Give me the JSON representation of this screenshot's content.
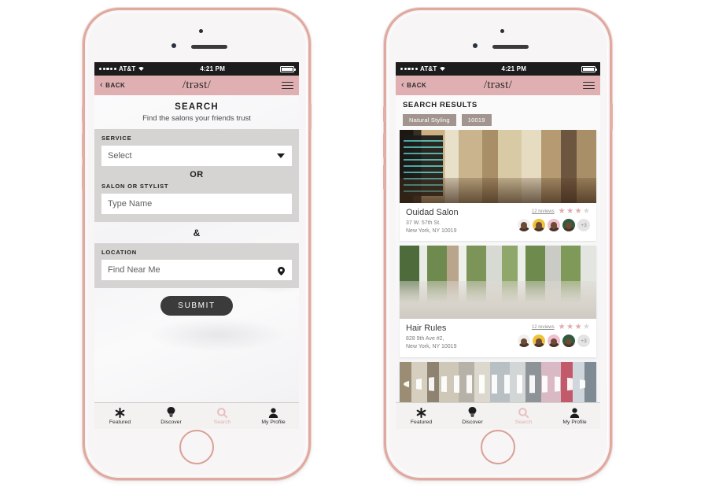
{
  "statusbar": {
    "carrier": "AT&T",
    "time": "4:21 PM",
    "signal_dots": 5
  },
  "navbar": {
    "back_label": "BACK",
    "logo": "/trəst/",
    "menu_icon": "hamburger-icon"
  },
  "left_screen": {
    "heading": "SEARCH",
    "subheading": "Find the salons your friends trust",
    "service": {
      "label": "SERVICE",
      "value": "Select",
      "icon": "chevron-down-icon"
    },
    "divider_or": "OR",
    "salon_or_stylist": {
      "label": "SALON OR STYLIST",
      "placeholder": "Type Name",
      "value": ""
    },
    "divider_and": "&",
    "location": {
      "label": "LOCATION",
      "placeholder": "Find Near Me",
      "value": "",
      "icon": "map-pin-icon"
    },
    "submit_label": "SUBMIT"
  },
  "right_screen": {
    "heading": "SEARCH RESULTS",
    "tags": [
      "Natural Styling",
      "10019"
    ],
    "results": [
      {
        "name": "Ouidad Salon",
        "address_line1": "37 W. 57th St.",
        "address_line2": "New York, NY 10019",
        "reviews": "12 reviews",
        "stars_filled": 3,
        "stars_total": 4,
        "avatar_overflow": "+3",
        "photo": "salon-interior-reception"
      },
      {
        "name": "Hair Rules",
        "address_line1": "828 9th Ave #2,",
        "address_line2": "New York, NY 10019",
        "reviews": "12 reviews",
        "stars_filled": 3,
        "stars_total": 4,
        "avatar_overflow": "+3",
        "photo": "salon-styling-chairs"
      },
      {
        "name": "",
        "address_line1": "",
        "address_line2": "",
        "reviews": "",
        "stars_filled": 0,
        "stars_total": 4,
        "avatar_overflow": "",
        "photo": "salon-vanity-mirrors"
      }
    ]
  },
  "tabbar": {
    "items": [
      {
        "label": "Featured",
        "icon": "asterisk-icon",
        "active": false
      },
      {
        "label": "Discover",
        "icon": "lightbulb-icon",
        "active": false
      },
      {
        "label": "Search",
        "icon": "magnifier-icon",
        "active": true
      },
      {
        "label": "My Profile",
        "icon": "person-icon",
        "active": false
      }
    ]
  },
  "colors": {
    "accent_pink": "#e0afb1",
    "frame_rose_gold": "#e0a99f",
    "panel_gray": "#d6d4d2",
    "tag_taupe": "#a2958f",
    "submit_dark": "#3b3b3b",
    "star_filled": "#e2a9ad",
    "star_empty": "#d8d8d8"
  }
}
